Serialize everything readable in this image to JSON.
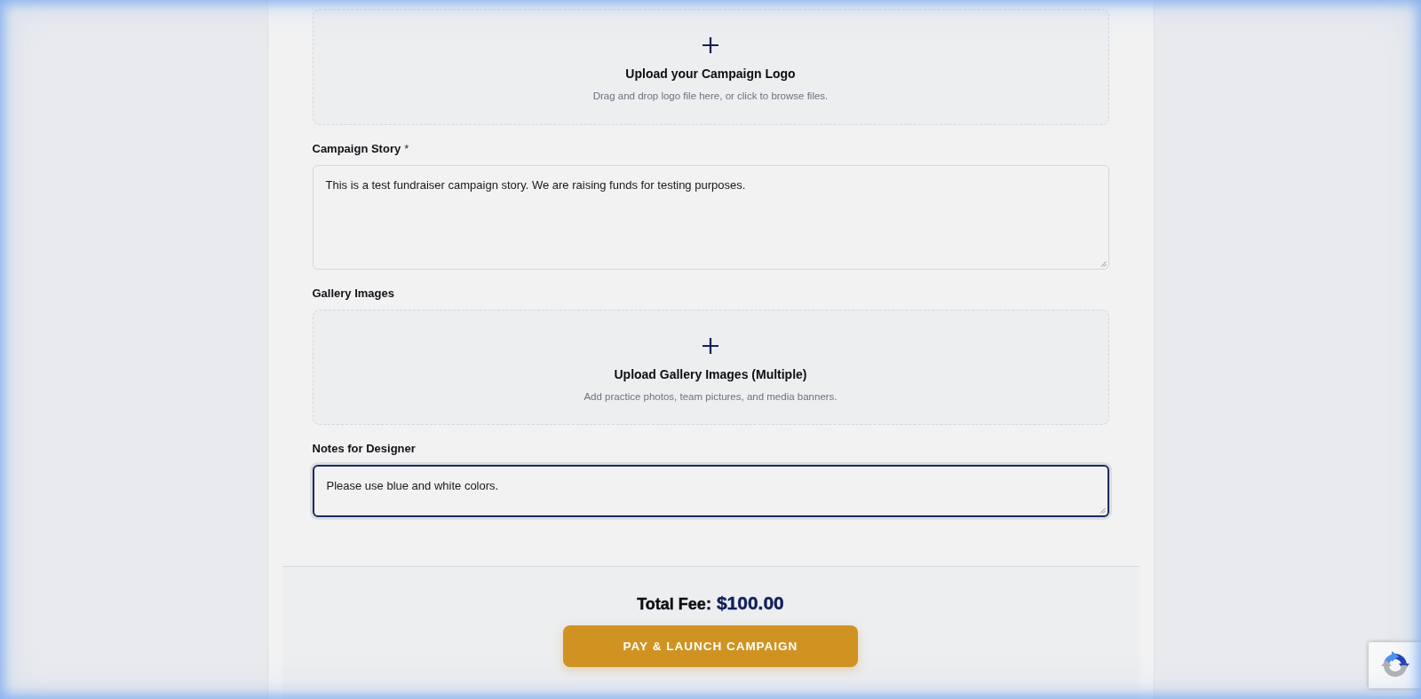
{
  "sections": [
    {
      "kind": "upload",
      "title": "Upload your Campaign Logo",
      "hint": "Drag and drop logo file here, or click to browse files."
    },
    {
      "kind": "textarea",
      "label": "Campaign Story",
      "required_mark": "*",
      "value": "This is a test fundraiser campaign story. We are raising funds for testing purposes.",
      "focused": false
    },
    {
      "kind": "upload",
      "label": "Gallery Images",
      "title": "Upload Gallery Images (Multiple)",
      "hint": "Add practice photos, team pictures, and media banners."
    },
    {
      "kind": "textarea",
      "label": "Notes for Designer",
      "value": "Please use blue and white colors.",
      "focused": true
    }
  ],
  "footer": {
    "total_label": "Total Fee:",
    "total_amount": "$100.00",
    "button": "PAY & LAUNCH CAMPAIGN"
  }
}
